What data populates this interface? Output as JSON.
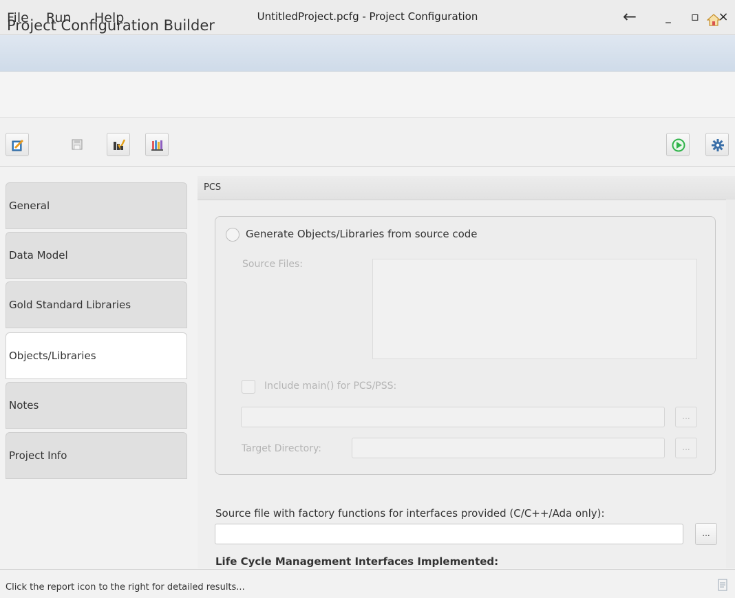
{
  "window": {
    "title": "UntitledProject.pcfg - Project Configuration",
    "minimize": "_",
    "maximize": "▫",
    "close": "×"
  },
  "menu": {
    "file": "File",
    "run": "Run",
    "help": "Help",
    "back": "←"
  },
  "header": {
    "title": "Project Configuration Builder"
  },
  "toolbar": {
    "left_icons": [
      "edit-icon",
      "save-icon",
      "validate-icon",
      "library-icon"
    ],
    "right_icons": [
      "run-icon",
      "settings-icon"
    ]
  },
  "sidebar": {
    "tabs": [
      {
        "label": "General"
      },
      {
        "label": "Data Model"
      },
      {
        "label": "Gold Standard Libraries"
      },
      {
        "label": "Objects/Libraries"
      },
      {
        "label": "Notes"
      },
      {
        "label": "Project Info"
      }
    ],
    "active_index": 3
  },
  "pcs": {
    "section_title": "PCS",
    "generate_label": "Generate Objects/Libraries from source code",
    "source_files_label": "Source Files:",
    "list_actions": [
      "add-file-icon",
      "add-folder-icon",
      "remove-icon",
      "move-up-icon",
      "move-down-icon"
    ],
    "include_main_label": "Include main() for PCS/PSS:",
    "include_main_value": "",
    "target_dir_label": "Target Directory:",
    "target_dir_value": "",
    "browse_label": "...",
    "factory_label": "Source file with factory functions for interfaces provided (C/C++/Ada only):",
    "factory_value": "",
    "lifecycle_label": "Life Cycle Management Interfaces Implemented:"
  },
  "status": {
    "text": "Click the report icon to the right for detailed results..."
  },
  "colors": {
    "menubar": "#d6e0ec",
    "active_tab": "#ffffff",
    "inactive_tab": "#e0e0e0",
    "run_green": "#2fb34a",
    "remove_red": "#e05050",
    "arrow_blue": "#6fb2df"
  }
}
